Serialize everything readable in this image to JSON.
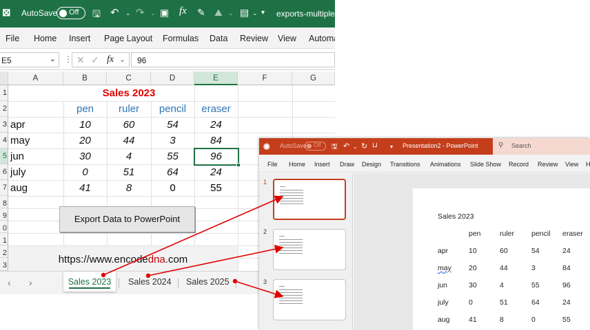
{
  "excel": {
    "title_bar": {
      "autosave_label": "AutoSave",
      "autosave_state": "Off",
      "doc_name": "exports-multiple-"
    },
    "menu": [
      "File",
      "Home",
      "Insert",
      "Page Layout",
      "Formulas",
      "Data",
      "Review",
      "View",
      "Automa"
    ],
    "formula_bar": {
      "name_box": "E5",
      "fx": "fx",
      "value": "96"
    },
    "columns": [
      "A",
      "B",
      "C",
      "D",
      "E",
      "F",
      "G"
    ],
    "rows": [
      "1",
      "2",
      "3",
      "4",
      "5",
      "6",
      "7",
      "8",
      "9",
      "0",
      "1",
      "2",
      "3"
    ],
    "sheet": {
      "title": "Sales 2023",
      "headers": [
        "pen",
        "ruler",
        "pencil",
        "eraser"
      ],
      "data": [
        {
          "month": "apr",
          "values": [
            "10",
            "60",
            "54",
            "24"
          ]
        },
        {
          "month": "may",
          "values": [
            "20",
            "44",
            "3",
            "84"
          ]
        },
        {
          "month": "jun",
          "values": [
            "30",
            "4",
            "55",
            "96"
          ]
        },
        {
          "month": "july",
          "values": [
            "0",
            "51",
            "64",
            "24"
          ]
        },
        {
          "month": "aug",
          "values": [
            "41",
            "8",
            "0",
            "55"
          ]
        }
      ]
    },
    "export_button": "Export Data to PowerPoint",
    "url": {
      "prefix": "https://www.encode",
      "highlight": "dna",
      "suffix": ".com"
    },
    "tabs": [
      "Sales 2023",
      "Sales 2024",
      "Sales 2025"
    ],
    "colors": {
      "brand": "#1e7145",
      "title_red": "#e00000",
      "header_blue": "#2e75b6"
    }
  },
  "powerpoint": {
    "title_bar": {
      "autosave_label": "AutoSave",
      "autosave_state": "Off",
      "doc_name": "Presentation2 - PowerPoint",
      "search_placeholder": "Search"
    },
    "menu": [
      "File",
      "Home",
      "Insert",
      "Draw",
      "Design",
      "Transitions",
      "Animations",
      "Slide Show",
      "Record",
      "Review",
      "View",
      "H"
    ],
    "slide_numbers": [
      "1",
      "2",
      "3"
    ],
    "slide": {
      "title": "Sales 2023",
      "headers": [
        "pen",
        "ruler",
        "pencil",
        "eraser"
      ],
      "rows": [
        {
          "month": "apr",
          "values": [
            "10",
            "60",
            "54",
            "24"
          ]
        },
        {
          "month": "may",
          "values": [
            "20",
            "44",
            "3",
            "84"
          ]
        },
        {
          "month": "jun",
          "values": [
            "30",
            "4",
            "55",
            "96"
          ]
        },
        {
          "month": "july",
          "values": [
            "0",
            "51",
            "64",
            "24"
          ]
        },
        {
          "month": "aug",
          "values": [
            "41",
            "8",
            "0",
            "55"
          ]
        }
      ]
    },
    "colors": {
      "brand": "#c43e1c"
    }
  }
}
